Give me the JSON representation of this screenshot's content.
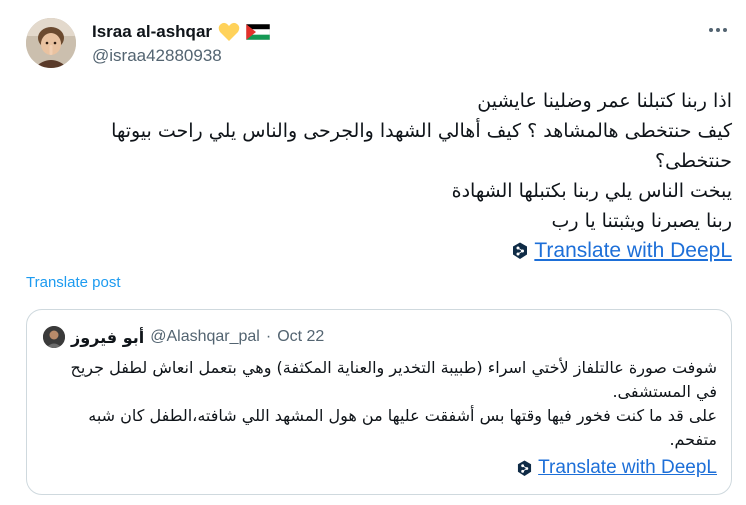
{
  "tweet": {
    "display_name": "Israa al-ashqar",
    "badges": [
      "yellow-heart-icon",
      "palestine-flag-icon"
    ],
    "handle": "@israa42880938",
    "more_icon": "more-horizontal-icon",
    "text_lines": [
      "اذا ربنا كتبلنا عمر وضلينا عايشين",
      "كيف حنتخطى هالمشاهد ؟ كيف أهالي الشهدا والجرحى والناس يلي راحت بيوتها حنتخطى؟",
      "يبخت الناس يلي ربنا بكتبلها الشهادة",
      "ربنا يصبرنا ويثبتنا يا رب"
    ],
    "deepl_label": "Translate with DeepL",
    "translate_post_label": "Translate post"
  },
  "quote": {
    "display_name": "أبو فيروز",
    "handle": "@Alashqar_pal",
    "separator": "·",
    "date": "Oct 22",
    "text_lines": [
      "شوفت صورة عالتلفاز لأختي اسراء (طبيبة التخدير والعناية المكثفة) وهي بتعمل انعاش لطفل جريح في المستشفى.",
      "على قد ما كنت فخور فيها وقتها بس أشفقت عليها من هول المشهد اللي شافته،الطفل كان شبه متفحم."
    ],
    "deepl_label": "Translate with DeepL"
  },
  "colors": {
    "link_blue": "#1d9bf0",
    "deepl_blue": "#1d6fd8",
    "secondary_text": "#536471",
    "border": "#cfd9de",
    "heart": "#ffd25a",
    "flag_green": "#149954",
    "flag_red": "#e4312b"
  }
}
